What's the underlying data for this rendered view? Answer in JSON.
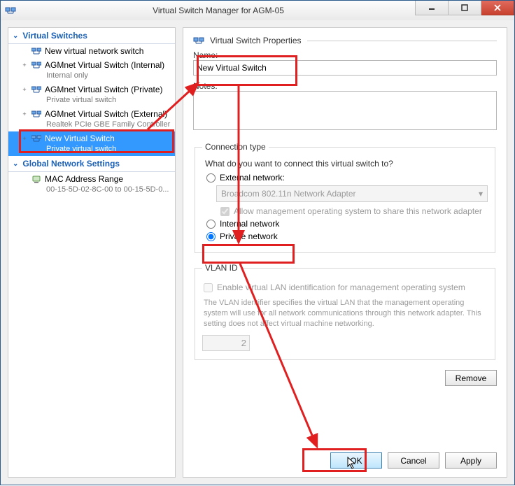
{
  "window": {
    "title": "Virtual Switch Manager for AGM-05"
  },
  "tree": {
    "switches_header": "Virtual Switches",
    "items": [
      {
        "label": "New virtual network switch",
        "sub": "",
        "expander": ""
      },
      {
        "label": "AGMnet Virtual Switch (Internal)",
        "sub": "Internal only",
        "expander": "+"
      },
      {
        "label": "AGMnet Virtual Switch (Private)",
        "sub": "Private virtual switch",
        "expander": "+"
      },
      {
        "label": "AGMnet Virtual Switch (External)",
        "sub": "Realtek PCIe GBE Family Controller",
        "expander": "+"
      },
      {
        "label": "New Virtual Switch",
        "sub": "Private virtual switch",
        "expander": "+",
        "selected": true
      }
    ],
    "global_header": "Global Network Settings",
    "mac_label": "MAC Address Range",
    "mac_value": "00-15-5D-02-8C-00 to 00-15-5D-0..."
  },
  "props": {
    "group_title": "Virtual Switch Properties",
    "name_label": "Name:",
    "name_value": "New Virtual Switch",
    "notes_label": "Notes:",
    "notes_value": ""
  },
  "conn": {
    "legend": "Connection type",
    "question": "What do you want to connect this virtual switch to?",
    "external_label": "External network:",
    "adapter_value": "Broadcom 802.11n Network Adapter",
    "allow_mgmt_label": "Allow management operating system to share this network adapter",
    "internal_label": "Internal network",
    "private_label": "Private network",
    "selected": "private"
  },
  "vlan": {
    "legend": "VLAN ID",
    "enable_label": "Enable virtual LAN identification for management operating system",
    "help": "The VLAN identifier specifies the virtual LAN that the management operating system will use for all network communications through this network adapter. This setting does not affect virtual machine networking.",
    "id_value": "2"
  },
  "buttons": {
    "remove": "Remove",
    "ok": "OK",
    "cancel": "Cancel",
    "apply": "Apply"
  }
}
